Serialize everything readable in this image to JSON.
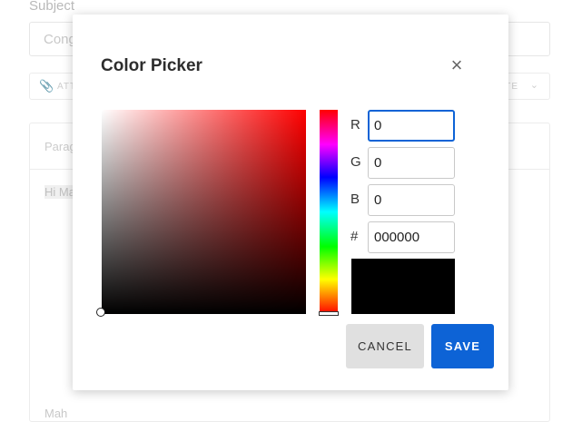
{
  "background": {
    "subject_label": "Subject",
    "subject_value": "Cong",
    "attach_label": "ATT",
    "template_label": "TE",
    "paragraph_label": "Parag",
    "body_text": "Hi Ma",
    "footer_text": "Mah"
  },
  "modal": {
    "title": "Color Picker",
    "close_symbol": "×",
    "channels": {
      "r_label": "R",
      "r_value": "0",
      "g_label": "G",
      "g_value": "0",
      "b_label": "B",
      "b_value": "0",
      "hex_label": "#",
      "hex_value": "000000"
    },
    "hue_color": "#ff0000",
    "selected_color": "#000000",
    "cancel_label": "CANCEL",
    "save_label": "SAVE",
    "accent_color": "#0d63d6"
  }
}
